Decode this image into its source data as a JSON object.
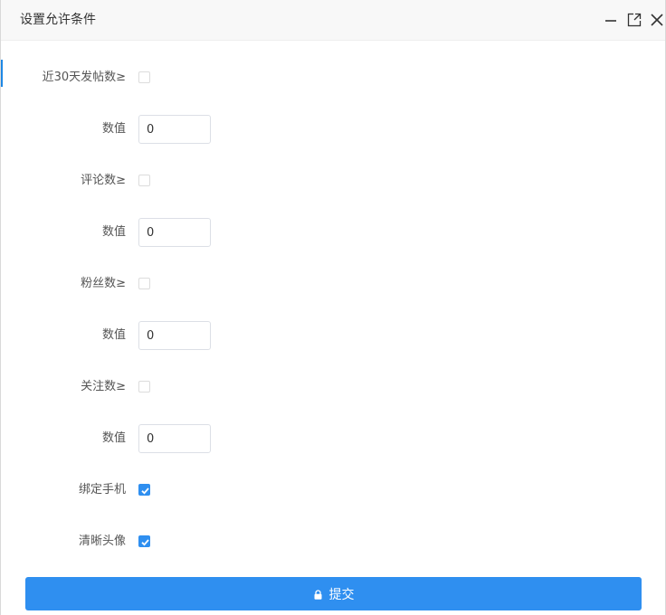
{
  "dialog": {
    "title": "设置允许条件",
    "controls": {
      "minimize_icon": "minimize-icon",
      "maximize_icon": "maximize-icon",
      "close_icon": "close-icon"
    }
  },
  "form": {
    "posts_30d": {
      "checkbox_label": "近30天发帖数≥",
      "checked": false,
      "value_label": "数值",
      "value": "0"
    },
    "comments": {
      "checkbox_label": "评论数≥",
      "checked": false,
      "value_label": "数值",
      "value": "0"
    },
    "followers": {
      "checkbox_label": "粉丝数≥",
      "checked": false,
      "value_label": "数值",
      "value": "0"
    },
    "following": {
      "checkbox_label": "关注数≥",
      "checked": false,
      "value_label": "数值",
      "value": "0"
    },
    "bind_phone": {
      "label": "绑定手机",
      "checked": true
    },
    "clear_avatar": {
      "label": "清晰头像",
      "checked": true
    }
  },
  "submit": {
    "label": "提交",
    "icon": "lock-icon"
  },
  "colors": {
    "accent": "#2f8ff0",
    "title_bar": "#f8f8f8"
  }
}
